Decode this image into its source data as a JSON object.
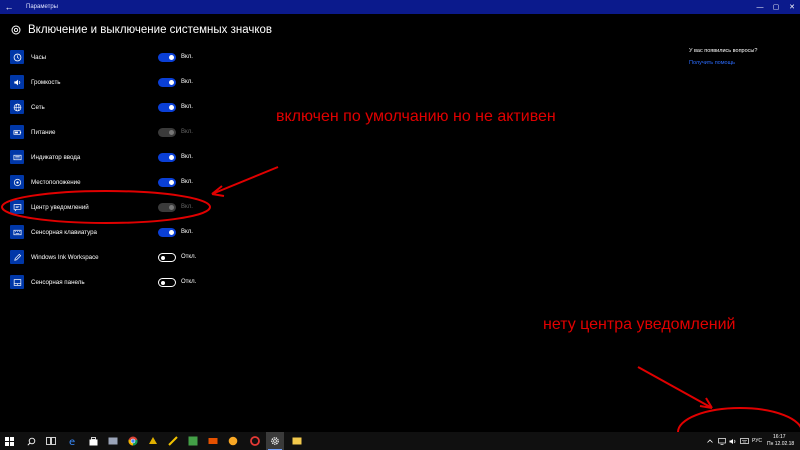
{
  "window": {
    "title": "Параметры",
    "back_glyph": "←",
    "minimize_glyph": "—",
    "maximize_glyph": "▢",
    "close_glyph": "✕"
  },
  "page": {
    "title": "Включение и выключение системных значков"
  },
  "icons": [
    {
      "label": "Часы",
      "icon": "clock-icon",
      "state": "on",
      "state_label": "Вкл."
    },
    {
      "label": "Громкость",
      "icon": "volume-icon",
      "state": "on",
      "state_label": "Вкл."
    },
    {
      "label": "Сеть",
      "icon": "network-icon",
      "state": "on",
      "state_label": "Вкл."
    },
    {
      "label": "Питание",
      "icon": "battery-icon",
      "state": "disabled",
      "state_label": "Вкл."
    },
    {
      "label": "Индикатор ввода",
      "icon": "keyboard-icon",
      "state": "on",
      "state_label": "Вкл."
    },
    {
      "label": "Местоположение",
      "icon": "location-icon",
      "state": "on",
      "state_label": "Вкл."
    },
    {
      "label": "Центр уведомлений",
      "icon": "action-center-icon",
      "state": "disabled",
      "state_label": "Вкл."
    },
    {
      "label": "Сенсорная клавиатура",
      "icon": "touch-keyboard-icon",
      "state": "on",
      "state_label": "Вкл."
    },
    {
      "label": "Windows Ink Workspace",
      "icon": "pen-icon",
      "state": "off",
      "state_label": "Откл."
    },
    {
      "label": "Сенсорная панель",
      "icon": "touchpad-icon",
      "state": "off",
      "state_label": "Откл."
    }
  ],
  "help": {
    "title": "У вас появились вопросы?",
    "link": "Получить помощь"
  },
  "annotations": {
    "top": "включен по умолчанию но не активен",
    "bottom": "нету центра уведомлений",
    "color": "#e00000"
  },
  "taskbar": {
    "apps": [
      "start-icon",
      "search-icon",
      "task-view-icon",
      "edge-icon",
      "store-icon",
      "app-icon",
      "chrome-icon",
      "app-icon",
      "app-icon",
      "app-icon",
      "app-icon",
      "app-icon",
      "app-icon",
      "settings-icon",
      "app-icon"
    ],
    "language": "РУС",
    "time": "16:17",
    "date": "Пн 12.02.18"
  },
  "colors": {
    "accent": "#0a3fd6",
    "titlebar": "#0b1a8c",
    "link": "#2b6cff"
  }
}
